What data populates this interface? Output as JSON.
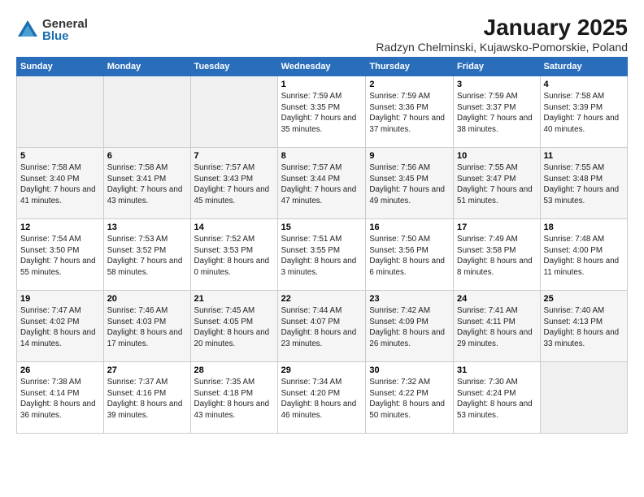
{
  "logo": {
    "general": "General",
    "blue": "Blue"
  },
  "title": "January 2025",
  "subtitle": "Radzyn Chelminski, Kujawsko-Pomorskie, Poland",
  "days_of_week": [
    "Sunday",
    "Monday",
    "Tuesday",
    "Wednesday",
    "Thursday",
    "Friday",
    "Saturday"
  ],
  "weeks": [
    [
      {
        "day": "",
        "info": ""
      },
      {
        "day": "",
        "info": ""
      },
      {
        "day": "",
        "info": ""
      },
      {
        "day": "1",
        "info": "Sunrise: 7:59 AM\nSunset: 3:35 PM\nDaylight: 7 hours and 35 minutes."
      },
      {
        "day": "2",
        "info": "Sunrise: 7:59 AM\nSunset: 3:36 PM\nDaylight: 7 hours and 37 minutes."
      },
      {
        "day": "3",
        "info": "Sunrise: 7:59 AM\nSunset: 3:37 PM\nDaylight: 7 hours and 38 minutes."
      },
      {
        "day": "4",
        "info": "Sunrise: 7:58 AM\nSunset: 3:39 PM\nDaylight: 7 hours and 40 minutes."
      }
    ],
    [
      {
        "day": "5",
        "info": "Sunrise: 7:58 AM\nSunset: 3:40 PM\nDaylight: 7 hours and 41 minutes."
      },
      {
        "day": "6",
        "info": "Sunrise: 7:58 AM\nSunset: 3:41 PM\nDaylight: 7 hours and 43 minutes."
      },
      {
        "day": "7",
        "info": "Sunrise: 7:57 AM\nSunset: 3:43 PM\nDaylight: 7 hours and 45 minutes."
      },
      {
        "day": "8",
        "info": "Sunrise: 7:57 AM\nSunset: 3:44 PM\nDaylight: 7 hours and 47 minutes."
      },
      {
        "day": "9",
        "info": "Sunrise: 7:56 AM\nSunset: 3:45 PM\nDaylight: 7 hours and 49 minutes."
      },
      {
        "day": "10",
        "info": "Sunrise: 7:55 AM\nSunset: 3:47 PM\nDaylight: 7 hours and 51 minutes."
      },
      {
        "day": "11",
        "info": "Sunrise: 7:55 AM\nSunset: 3:48 PM\nDaylight: 7 hours and 53 minutes."
      }
    ],
    [
      {
        "day": "12",
        "info": "Sunrise: 7:54 AM\nSunset: 3:50 PM\nDaylight: 7 hours and 55 minutes."
      },
      {
        "day": "13",
        "info": "Sunrise: 7:53 AM\nSunset: 3:52 PM\nDaylight: 7 hours and 58 minutes."
      },
      {
        "day": "14",
        "info": "Sunrise: 7:52 AM\nSunset: 3:53 PM\nDaylight: 8 hours and 0 minutes."
      },
      {
        "day": "15",
        "info": "Sunrise: 7:51 AM\nSunset: 3:55 PM\nDaylight: 8 hours and 3 minutes."
      },
      {
        "day": "16",
        "info": "Sunrise: 7:50 AM\nSunset: 3:56 PM\nDaylight: 8 hours and 6 minutes."
      },
      {
        "day": "17",
        "info": "Sunrise: 7:49 AM\nSunset: 3:58 PM\nDaylight: 8 hours and 8 minutes."
      },
      {
        "day": "18",
        "info": "Sunrise: 7:48 AM\nSunset: 4:00 PM\nDaylight: 8 hours and 11 minutes."
      }
    ],
    [
      {
        "day": "19",
        "info": "Sunrise: 7:47 AM\nSunset: 4:02 PM\nDaylight: 8 hours and 14 minutes."
      },
      {
        "day": "20",
        "info": "Sunrise: 7:46 AM\nSunset: 4:03 PM\nDaylight: 8 hours and 17 minutes."
      },
      {
        "day": "21",
        "info": "Sunrise: 7:45 AM\nSunset: 4:05 PM\nDaylight: 8 hours and 20 minutes."
      },
      {
        "day": "22",
        "info": "Sunrise: 7:44 AM\nSunset: 4:07 PM\nDaylight: 8 hours and 23 minutes."
      },
      {
        "day": "23",
        "info": "Sunrise: 7:42 AM\nSunset: 4:09 PM\nDaylight: 8 hours and 26 minutes."
      },
      {
        "day": "24",
        "info": "Sunrise: 7:41 AM\nSunset: 4:11 PM\nDaylight: 8 hours and 29 minutes."
      },
      {
        "day": "25",
        "info": "Sunrise: 7:40 AM\nSunset: 4:13 PM\nDaylight: 8 hours and 33 minutes."
      }
    ],
    [
      {
        "day": "26",
        "info": "Sunrise: 7:38 AM\nSunset: 4:14 PM\nDaylight: 8 hours and 36 minutes."
      },
      {
        "day": "27",
        "info": "Sunrise: 7:37 AM\nSunset: 4:16 PM\nDaylight: 8 hours and 39 minutes."
      },
      {
        "day": "28",
        "info": "Sunrise: 7:35 AM\nSunset: 4:18 PM\nDaylight: 8 hours and 43 minutes."
      },
      {
        "day": "29",
        "info": "Sunrise: 7:34 AM\nSunset: 4:20 PM\nDaylight: 8 hours and 46 minutes."
      },
      {
        "day": "30",
        "info": "Sunrise: 7:32 AM\nSunset: 4:22 PM\nDaylight: 8 hours and 50 minutes."
      },
      {
        "day": "31",
        "info": "Sunrise: 7:30 AM\nSunset: 4:24 PM\nDaylight: 8 hours and 53 minutes."
      },
      {
        "day": "",
        "info": ""
      }
    ]
  ]
}
